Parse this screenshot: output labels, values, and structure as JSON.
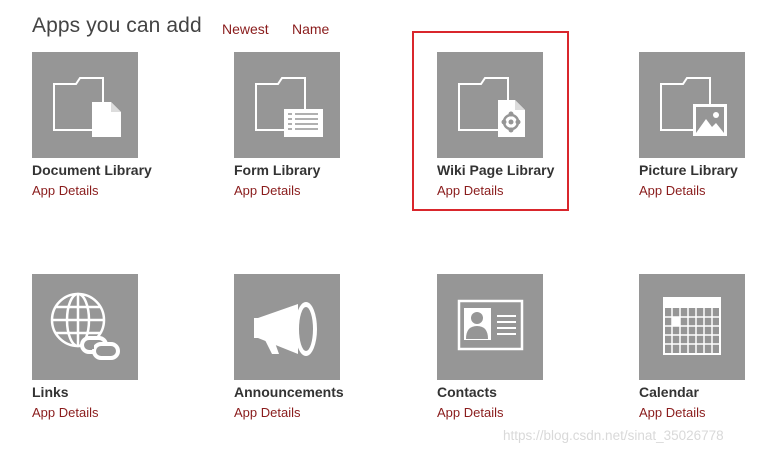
{
  "header": {
    "title": "Apps you can add",
    "sort_newest": "Newest",
    "sort_name": "Name"
  },
  "apps": [
    {
      "name": "Document Library",
      "details": "App Details",
      "icon": "document-library-icon"
    },
    {
      "name": "Form Library",
      "details": "App Details",
      "icon": "form-library-icon"
    },
    {
      "name": "Wiki Page Library",
      "details": "App Details",
      "icon": "wiki-page-library-icon"
    },
    {
      "name": "Picture Library",
      "details": "App Details",
      "icon": "picture-library-icon"
    },
    {
      "name": "Links",
      "details": "App Details",
      "icon": "links-icon"
    },
    {
      "name": "Announcements",
      "details": "App Details",
      "icon": "announcements-icon"
    },
    {
      "name": "Contacts",
      "details": "App Details",
      "icon": "contacts-icon"
    },
    {
      "name": "Calendar",
      "details": "App Details",
      "icon": "calendar-icon"
    }
  ],
  "watermark": "https://blog.csdn.net/sinat_35026778",
  "colors": {
    "tile": "#969696",
    "link": "#8a1c1c",
    "highlight": "#d9262c",
    "title": "#444444"
  }
}
